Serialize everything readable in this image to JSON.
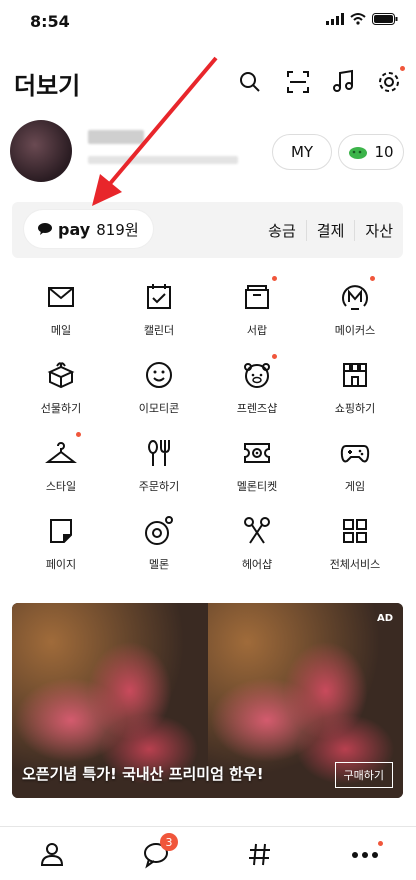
{
  "status_bar": {
    "time": "8:54"
  },
  "header": {
    "title": "더보기"
  },
  "profile": {
    "my_button": "MY",
    "coin_count": "10"
  },
  "pay": {
    "brand": "pay",
    "balance": "819원",
    "actions": [
      "송금",
      "결제",
      "자산"
    ]
  },
  "services": [
    {
      "label": "메일",
      "icon": "mail-icon",
      "dot": false
    },
    {
      "label": "캘린더",
      "icon": "calendar-icon",
      "dot": false
    },
    {
      "label": "서랍",
      "icon": "drawer-icon",
      "dot": true
    },
    {
      "label": "메이커스",
      "icon": "makers-icon",
      "dot": true
    },
    {
      "label": "선물하기",
      "icon": "gift-icon",
      "dot": false
    },
    {
      "label": "이모티콘",
      "icon": "emoticon-icon",
      "dot": false
    },
    {
      "label": "프렌즈샵",
      "icon": "friends-shop-icon",
      "dot": true
    },
    {
      "label": "쇼핑하기",
      "icon": "shopping-icon",
      "dot": false
    },
    {
      "label": "스타일",
      "icon": "style-hanger-icon",
      "dot": true
    },
    {
      "label": "주문하기",
      "icon": "order-utensils-icon",
      "dot": false
    },
    {
      "label": "멜론티켓",
      "icon": "melon-ticket-icon",
      "dot": false
    },
    {
      "label": "게임",
      "icon": "game-controller-icon",
      "dot": false
    },
    {
      "label": "페이지",
      "icon": "page-icon",
      "dot": false
    },
    {
      "label": "멜론",
      "icon": "melon-icon",
      "dot": false
    },
    {
      "label": "헤어샵",
      "icon": "hair-scissors-icon",
      "dot": false
    },
    {
      "label": "전체서비스",
      "icon": "all-services-icon",
      "dot": false
    }
  ],
  "ad": {
    "label": "AD",
    "text": "오픈기념 특가! 국내산 프리미엄 한우!",
    "button": "구매하기"
  },
  "tabbar": {
    "chat_badge": "3"
  },
  "colors": {
    "accent_red": "#f0563b",
    "annotation_arrow": "#e8262b"
  }
}
